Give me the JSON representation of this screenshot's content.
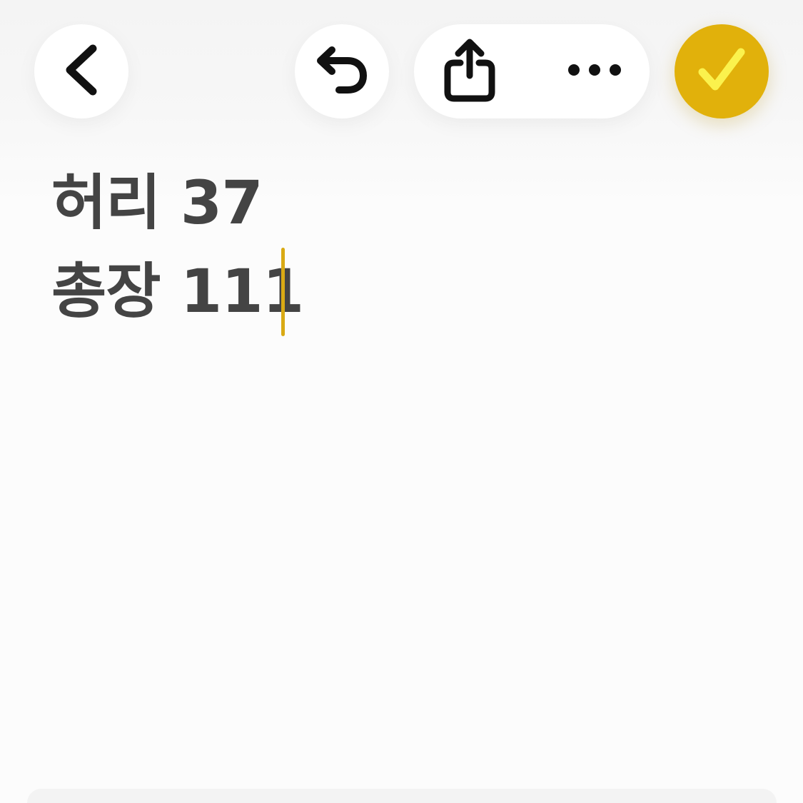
{
  "toolbar": {
    "back_icon": "chevron-left-icon",
    "undo_icon": "undo-arrow-icon",
    "share_icon": "share-icon",
    "more_icon": "ellipsis-icon",
    "done_icon": "checkmark-icon",
    "done_color": "#e1b10b",
    "done_check_color": "#fbf24d"
  },
  "note": {
    "lines": [
      "허리 37",
      "총장 111"
    ],
    "text_color": "#444444",
    "caret_color": "#d9aa14"
  }
}
